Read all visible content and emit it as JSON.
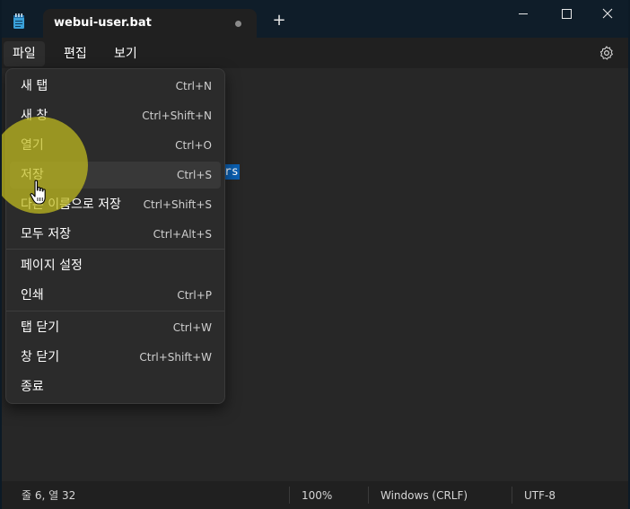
{
  "window": {
    "tab_title": "webui-user.bat",
    "new_tab_label": "+",
    "controls": {
      "minimize": "—",
      "maximize": "☐",
      "close": "✕"
    }
  },
  "menubar": {
    "file": "파일",
    "edit": "편집",
    "view": "보기"
  },
  "editor": {
    "selected_text": "rs"
  },
  "file_menu": {
    "items": [
      {
        "label": "새 탭",
        "shortcut": "Ctrl+N"
      },
      {
        "label": "새 창",
        "shortcut": "Ctrl+Shift+N"
      },
      {
        "label": "열기",
        "shortcut": "Ctrl+O"
      },
      {
        "label": "저장",
        "shortcut": "Ctrl+S"
      },
      {
        "label": "다른 이름으로 저장",
        "shortcut": "Ctrl+Shift+S"
      },
      {
        "label": "모두 저장",
        "shortcut": "Ctrl+Alt+S"
      },
      {
        "label": "페이지 설정",
        "shortcut": ""
      },
      {
        "label": "인쇄",
        "shortcut": "Ctrl+P"
      },
      {
        "label": "탭 닫기",
        "shortcut": "Ctrl+W"
      },
      {
        "label": "창 닫기",
        "shortcut": "Ctrl+Shift+W"
      },
      {
        "label": "종료",
        "shortcut": ""
      }
    ]
  },
  "statusbar": {
    "position": "줄 6, 열 32",
    "zoom": "100%",
    "line_ending": "Windows (CRLF)",
    "encoding": "UTF-8"
  },
  "colors": {
    "title_bar": "#0f1d29",
    "selection": "#0a5fb2",
    "click_highlight": "#c4be1e"
  }
}
